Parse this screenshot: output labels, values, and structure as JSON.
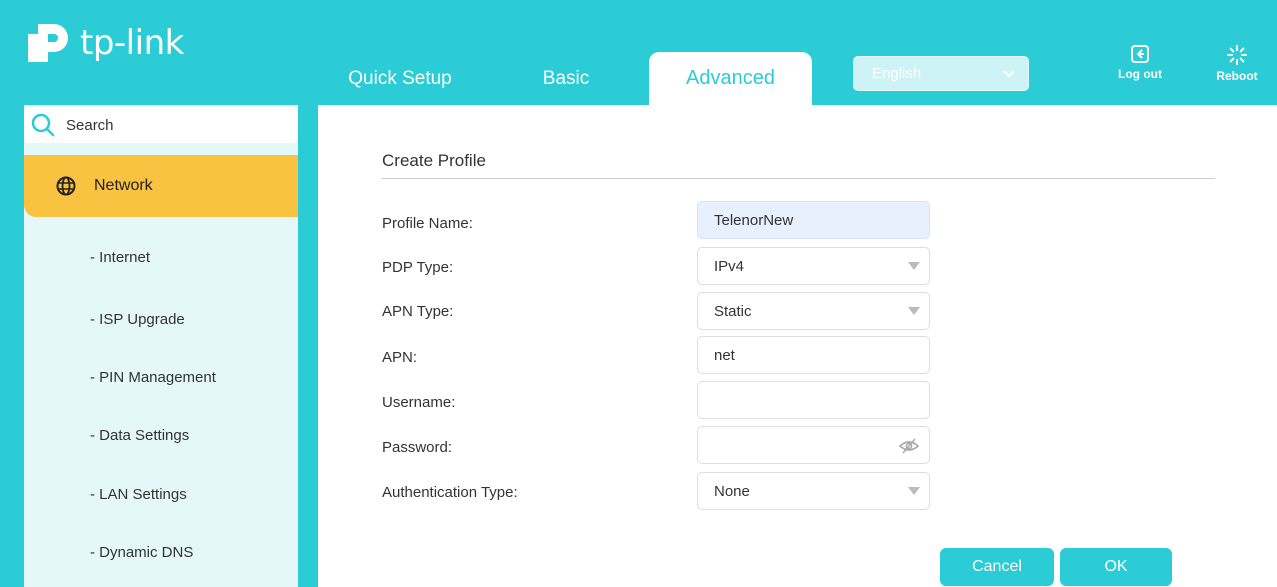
{
  "header": {
    "brand": "tp-link",
    "tabs": [
      {
        "label": "Quick Setup"
      },
      {
        "label": "Basic"
      },
      {
        "label": "Advanced"
      }
    ],
    "language": "English",
    "logout_label": "Log out",
    "reboot_label": "Reboot"
  },
  "sidebar": {
    "search_placeholder": "Search",
    "section": "Network",
    "items": [
      {
        "label": "- Internet"
      },
      {
        "label": "- ISP Upgrade"
      },
      {
        "label": "- PIN Management"
      },
      {
        "label": "- Data Settings"
      },
      {
        "label": "- LAN Settings"
      },
      {
        "label": "- Dynamic DNS"
      }
    ]
  },
  "form": {
    "title": "Create Profile",
    "fields": [
      {
        "label": "Profile Name:",
        "value": "TelenorNew"
      },
      {
        "label": "PDP Type:",
        "value": "IPv4"
      },
      {
        "label": "APN Type:",
        "value": "Static"
      },
      {
        "label": "APN:",
        "value": "net"
      },
      {
        "label": "Username:",
        "value": ""
      },
      {
        "label": "Password:",
        "value": ""
      },
      {
        "label": "Authentication Type:",
        "value": "None"
      }
    ],
    "cancel_label": "Cancel",
    "ok_label": "OK"
  },
  "colors": {
    "accent": "#2bccd6",
    "active_menu": "#f9c240",
    "sidebar_bg": "#e4f8fa"
  }
}
